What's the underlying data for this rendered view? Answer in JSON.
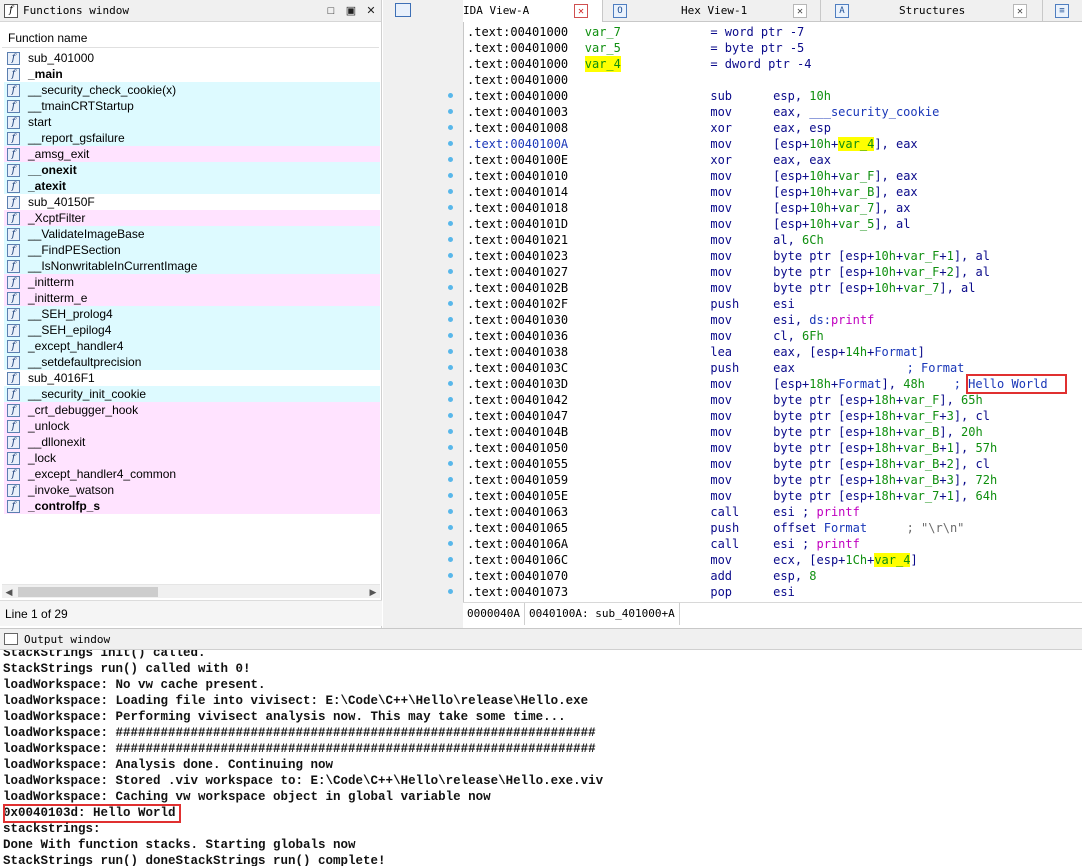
{
  "functions_window": {
    "title": "Functions window",
    "column_header": "Function name",
    "items": [
      {
        "name": "sub_401000",
        "bold": false,
        "color": "white"
      },
      {
        "name": "_main",
        "bold": true,
        "color": "white"
      },
      {
        "name": "__security_check_cookie(x)",
        "bold": false,
        "color": "cyan"
      },
      {
        "name": "__tmainCRTStartup",
        "bold": false,
        "color": "cyan"
      },
      {
        "name": "start",
        "bold": false,
        "color": "cyan"
      },
      {
        "name": "__report_gsfailure",
        "bold": false,
        "color": "cyan"
      },
      {
        "name": "_amsg_exit",
        "bold": false,
        "color": "pink"
      },
      {
        "name": "__onexit",
        "bold": true,
        "color": "cyan"
      },
      {
        "name": "_atexit",
        "bold": true,
        "color": "cyan"
      },
      {
        "name": "sub_40150F",
        "bold": false,
        "color": "white"
      },
      {
        "name": "_XcptFilter",
        "bold": false,
        "color": "pink"
      },
      {
        "name": "__ValidateImageBase",
        "bold": false,
        "color": "cyan"
      },
      {
        "name": "__FindPESection",
        "bold": false,
        "color": "cyan"
      },
      {
        "name": "__IsNonwritableInCurrentImage",
        "bold": false,
        "color": "cyan"
      },
      {
        "name": "_initterm",
        "bold": false,
        "color": "pink"
      },
      {
        "name": "_initterm_e",
        "bold": false,
        "color": "pink"
      },
      {
        "name": "__SEH_prolog4",
        "bold": false,
        "color": "cyan"
      },
      {
        "name": "__SEH_epilog4",
        "bold": false,
        "color": "cyan"
      },
      {
        "name": "_except_handler4",
        "bold": false,
        "color": "cyan"
      },
      {
        "name": "__setdefaultprecision",
        "bold": false,
        "color": "cyan"
      },
      {
        "name": "sub_4016F1",
        "bold": false,
        "color": "white"
      },
      {
        "name": "__security_init_cookie",
        "bold": false,
        "color": "cyan"
      },
      {
        "name": "_crt_debugger_hook",
        "bold": false,
        "color": "pink"
      },
      {
        "name": "_unlock",
        "bold": false,
        "color": "pink"
      },
      {
        "name": "__dllonexit",
        "bold": false,
        "color": "pink"
      },
      {
        "name": "_lock",
        "bold": false,
        "color": "pink"
      },
      {
        "name": "_except_handler4_common",
        "bold": false,
        "color": "pink"
      },
      {
        "name": "_invoke_watson",
        "bold": false,
        "color": "pink"
      },
      {
        "name": "_controlfp_s",
        "bold": true,
        "color": "pink"
      }
    ],
    "status": "Line 1 of 29"
  },
  "tabs": [
    {
      "label": "IDA View-A",
      "active": true
    },
    {
      "label": "Hex View-1",
      "active": false
    },
    {
      "label": "Structures",
      "active": false
    }
  ],
  "ida_view": {
    "header_lines": [
      {
        "addr": ".text:00401000",
        "name": "var_7",
        "eq": "= word ptr -7",
        "hl": false
      },
      {
        "addr": ".text:00401000",
        "name": "var_5",
        "eq": "= byte ptr -5",
        "hl": false
      },
      {
        "addr": ".text:00401000",
        "name": "var_4",
        "eq": "= dword ptr -4",
        "hl": true
      },
      {
        "addr": ".text:00401000",
        "name": "",
        "eq": "",
        "hl": false
      }
    ],
    "code_lines": [
      {
        "addr": ".text:00401000",
        "mn": "sub",
        "ops": "esp, 10h"
      },
      {
        "addr": ".text:00401003",
        "mn": "mov",
        "ops": "eax, ___security_cookie"
      },
      {
        "addr": ".text:00401008",
        "mn": "xor",
        "ops": "eax, esp"
      },
      {
        "addr": ".text:0040100A",
        "mn": "mov",
        "ops": "[esp+10h+var_4], eax"
      },
      {
        "addr": ".text:0040100E",
        "mn": "xor",
        "ops": "eax, eax"
      },
      {
        "addr": ".text:00401010",
        "mn": "mov",
        "ops": "[esp+10h+var_F], eax"
      },
      {
        "addr": ".text:00401014",
        "mn": "mov",
        "ops": "[esp+10h+var_B], eax"
      },
      {
        "addr": ".text:00401018",
        "mn": "mov",
        "ops": "[esp+10h+var_7], ax"
      },
      {
        "addr": ".text:0040101D",
        "mn": "mov",
        "ops": "[esp+10h+var_5], al"
      },
      {
        "addr": ".text:00401021",
        "mn": "mov",
        "ops": "al, 6Ch"
      },
      {
        "addr": ".text:00401023",
        "mn": "mov",
        "ops": "byte ptr [esp+10h+var_F+1], al"
      },
      {
        "addr": ".text:00401027",
        "mn": "mov",
        "ops": "byte ptr [esp+10h+var_F+2], al"
      },
      {
        "addr": ".text:0040102B",
        "mn": "mov",
        "ops": "byte ptr [esp+10h+var_7], al"
      },
      {
        "addr": ".text:0040102F",
        "mn": "push",
        "ops": "esi"
      },
      {
        "addr": ".text:00401030",
        "mn": "mov",
        "ops": "esi, ds:printf"
      },
      {
        "addr": ".text:00401036",
        "mn": "mov",
        "ops": "cl, 6Fh"
      },
      {
        "addr": ".text:00401038",
        "mn": "lea",
        "ops": "eax, [esp+14h+Format]"
      },
      {
        "addr": ".text:0040103C",
        "mn": "push",
        "ops": "eax",
        "cmt": "; Format"
      },
      {
        "addr": ".text:0040103D",
        "mn": "mov",
        "ops": "[esp+18h+Format], 48h",
        "cmt": "; Hello World"
      },
      {
        "addr": ".text:00401042",
        "mn": "mov",
        "ops": "byte ptr [esp+18h+var_F], 65h"
      },
      {
        "addr": ".text:00401047",
        "mn": "mov",
        "ops": "byte ptr [esp+18h+var_F+3], cl"
      },
      {
        "addr": ".text:0040104B",
        "mn": "mov",
        "ops": "byte ptr [esp+18h+var_B], 20h"
      },
      {
        "addr": ".text:00401050",
        "mn": "mov",
        "ops": "byte ptr [esp+18h+var_B+1], 57h"
      },
      {
        "addr": ".text:00401055",
        "mn": "mov",
        "ops": "byte ptr [esp+18h+var_B+2], cl"
      },
      {
        "addr": ".text:00401059",
        "mn": "mov",
        "ops": "byte ptr [esp+18h+var_B+3], 72h"
      },
      {
        "addr": ".text:0040105E",
        "mn": "mov",
        "ops": "byte ptr [esp+18h+var_7+1], 64h"
      },
      {
        "addr": ".text:00401063",
        "mn": "call",
        "ops": "esi ; printf"
      },
      {
        "addr": ".text:00401065",
        "mn": "push",
        "ops": "offset Format",
        "cmt": "; \"\\r\\n\""
      },
      {
        "addr": ".text:0040106A",
        "mn": "call",
        "ops": "esi ; printf"
      },
      {
        "addr": ".text:0040106C",
        "mn": "mov",
        "ops": "ecx, [esp+1Ch+var_4]"
      },
      {
        "addr": ".text:00401070",
        "mn": "add",
        "ops": "esp, 8"
      },
      {
        "addr": ".text:00401073",
        "mn": "pop",
        "ops": "esi"
      }
    ],
    "status_offset": "0000040A",
    "status_location": "0040100A: sub_401000+A"
  },
  "output_window": {
    "title": "Output window",
    "lines": [
      "StackStrings init() called.",
      "StackStrings run() called with 0!",
      "loadWorkspace: No vw cache present.",
      "loadWorkspace: Loading file into vivisect: E:\\Code\\C++\\Hello\\release\\Hello.exe",
      "loadWorkspace: Performing vivisect analysis now. This may take some time...",
      "loadWorkspace: ################################################################",
      "loadWorkspace: ################################################################",
      "loadWorkspace: Analysis done. Continuing now",
      "loadWorkspace: Stored .viv workspace to: E:\\Code\\C++\\Hello\\release\\Hello.exe.viv",
      "loadWorkspace: Caching vw workspace object in global variable now",
      "0x0040103d: Hello World",
      "stackstrings:",
      "Done With function stacks. Starting globals now",
      "StackStrings run() doneStackStrings run() complete!"
    ]
  },
  "colors": {
    "cyan_row": "#ddfaff",
    "pink_row": "#ffe3ff",
    "highlight": "#ffff00",
    "annotation": "#e03030",
    "dot": "#58b7ea"
  }
}
